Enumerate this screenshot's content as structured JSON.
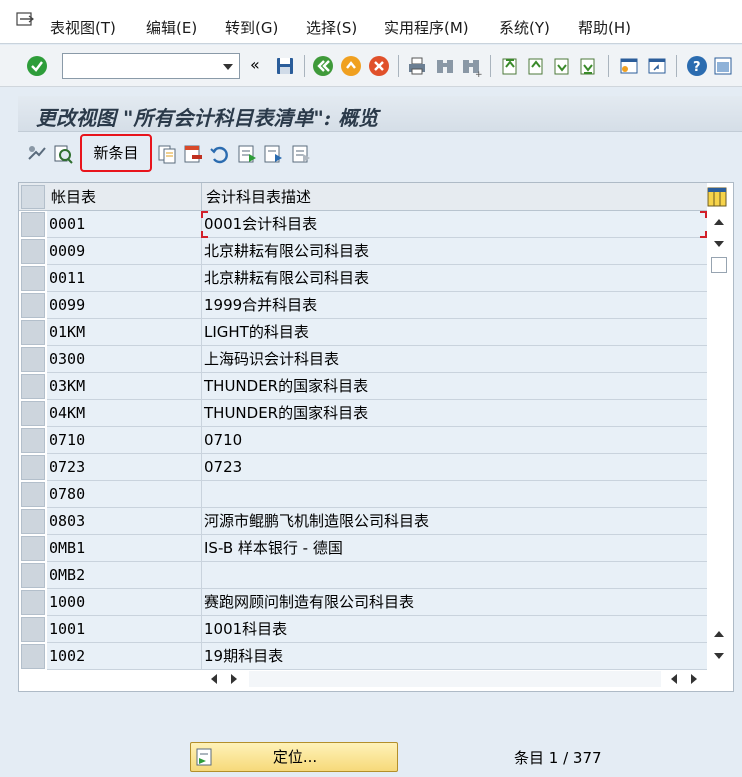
{
  "menu": {
    "items": [
      {
        "label": "表视图(T)"
      },
      {
        "label": "编辑(E)"
      },
      {
        "label": "转到(G)"
      },
      {
        "label": "选择(S)"
      },
      {
        "label": "实用程序(M)"
      },
      {
        "label": "系统(Y)"
      },
      {
        "label": "帮助(H)"
      }
    ]
  },
  "toolbar": {
    "command_value": "",
    "back_label": "«"
  },
  "title": "更改视图 \"所有会计科目表清单\": 概览",
  "app_toolbar": {
    "new_entries_label": "新条目"
  },
  "table": {
    "columns": [
      "帐目表",
      "会计科目表描述"
    ],
    "rows": [
      {
        "code": "0001",
        "desc": "0001会计科目表"
      },
      {
        "code": "0009",
        "desc": "北京耕耘有限公司科目表"
      },
      {
        "code": "0011",
        "desc": "北京耕耘有限公司科目表"
      },
      {
        "code": "0099",
        "desc": "1999合并科目表"
      },
      {
        "code": "01KM",
        "desc": "LIGHT的科目表"
      },
      {
        "code": "0300",
        "desc": "上海码识会计科目表"
      },
      {
        "code": "03KM",
        "desc": "THUNDER的国家科目表"
      },
      {
        "code": "04KM",
        "desc": "THUNDER的国家科目表"
      },
      {
        "code": "0710",
        "desc": "0710"
      },
      {
        "code": "0723",
        "desc": "0723"
      },
      {
        "code": "0780",
        "desc": ""
      },
      {
        "code": "0803",
        "desc": "河源市鲲鹏飞机制造限公司科目表"
      },
      {
        "code": "0MB1",
        "desc": "IS-B 样本银行 - 德国"
      },
      {
        "code": "0MB2",
        "desc": ""
      },
      {
        "code": "1000",
        "desc": "赛跑网顾问制造有限公司科目表"
      },
      {
        "code": "1001",
        "desc": "1001科目表"
      },
      {
        "code": "1002",
        "desc": "19期科目表"
      }
    ]
  },
  "footer": {
    "locate_label": "定位...",
    "entry_counter": "条目 1 / 377"
  },
  "colors": {
    "highlight_border": "#e8141c",
    "row_bg": "#e8f0f7",
    "background": "#e4ecf4"
  }
}
